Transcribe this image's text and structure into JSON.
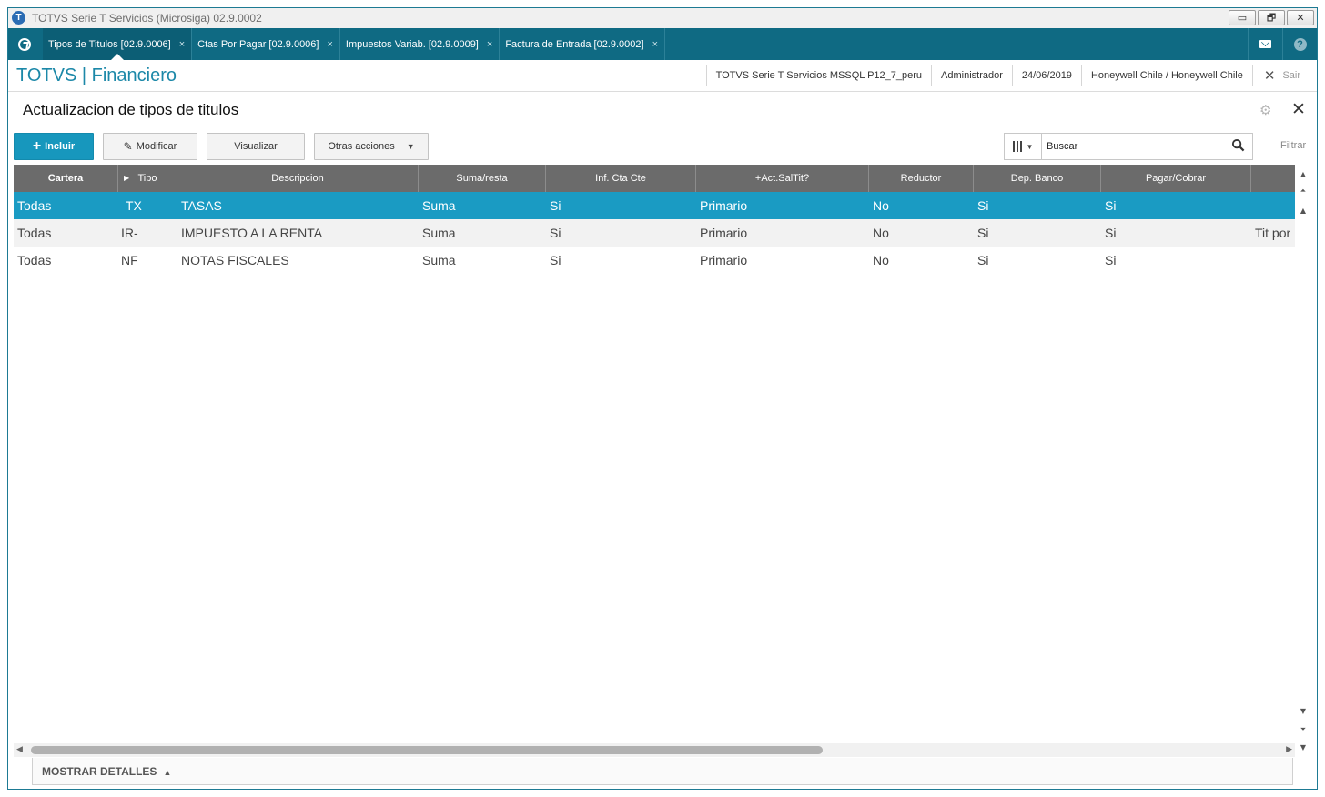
{
  "window": {
    "title": "TOTVS Serie T Servicios (Microsiga) 02.9.0002",
    "min": "▭",
    "restore": "🗗",
    "close": "✕"
  },
  "tabs": [
    {
      "label": "Tipos de Titulos [02.9.0006]",
      "close": "×"
    },
    {
      "label": "Ctas Por Pagar [02.9.0006]",
      "close": "×"
    },
    {
      "label": "Impuestos Variab. [02.9.0009]",
      "close": "×"
    },
    {
      "label": "Factura de Entrada [02.9.0002]",
      "close": "×"
    }
  ],
  "header": {
    "brand": "TOTVS | Financiero",
    "environment": "TOTVS Serie T Servicios MSSQL P12_7_peru",
    "user": "Administrador",
    "date": "24/06/2019",
    "company": "Honeywell Chile / Honeywell Chile",
    "exit": "Sair"
  },
  "page": {
    "title": "Actualizacion de tipos de titulos"
  },
  "toolbar": {
    "include": "Incluir",
    "modify": "Modificar",
    "view": "Visualizar",
    "other": "Otras acciones"
  },
  "search": {
    "value": "Buscar",
    "filter": "Filtrar"
  },
  "grid": {
    "columns": [
      "Cartera",
      "Tipo",
      "Descripcion",
      "Suma/resta",
      "Inf. Cta Cte",
      "+Act.SalTit?",
      "Reductor",
      "Dep. Banco",
      "Pagar/Cobrar"
    ],
    "rows": [
      [
        "Todas",
        "TX",
        "TASAS",
        "Suma",
        "Si",
        "Primario",
        "No",
        "Si",
        "Si",
        ""
      ],
      [
        "Todas",
        "IR-",
        "IMPUESTO A LA RENTA",
        "Suma",
        "Si",
        "Primario",
        "No",
        "Si",
        "Si",
        "Tit por"
      ],
      [
        "Todas",
        "NF",
        "NOTAS FISCALES",
        "Suma",
        "Si",
        "Primario",
        "No",
        "Si",
        "Si",
        ""
      ]
    ],
    "selected_row": 0
  },
  "footer": {
    "details": "MOSTRAR DETALLES"
  },
  "colors": {
    "accent": "#1797bd",
    "tabbar": "#0f6a83",
    "selected": "#1a9bc3",
    "header_grid": "#6b6b6b"
  }
}
